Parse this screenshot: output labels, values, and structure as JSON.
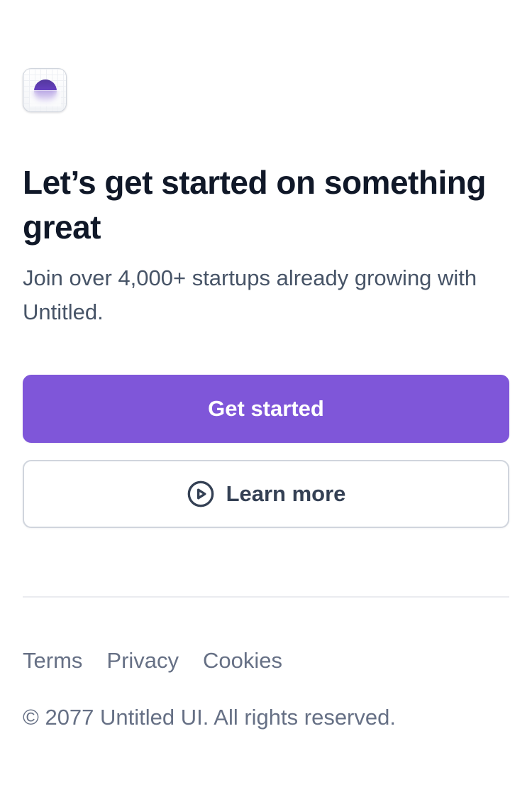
{
  "logo": {
    "icon": "untitled-ui-logo-icon"
  },
  "hero": {
    "title": "Let’s get started on something great",
    "subtitle": "Join over 4,000+ startups already growing with Untitled."
  },
  "actions": {
    "primary_label": "Get started",
    "secondary_label": "Learn more",
    "secondary_icon": "play-circle-icon"
  },
  "footer": {
    "links": [
      {
        "label": "Terms"
      },
      {
        "label": "Privacy"
      },
      {
        "label": "Cookies"
      }
    ],
    "copyright": "© 2077 Untitled UI. All rights reserved."
  },
  "colors": {
    "brand": "#7f56d9",
    "heading": "#101828",
    "body": "#475467",
    "muted": "#667085",
    "border": "#d0d5dd"
  }
}
